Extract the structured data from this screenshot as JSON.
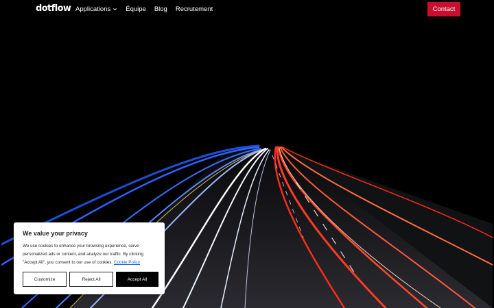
{
  "nav": {
    "logo": "dotflow",
    "items": [
      {
        "label": "Applications",
        "has_dropdown": true
      },
      {
        "label": "Équipe"
      },
      {
        "label": "Blog"
      },
      {
        "label": "Recrutement"
      }
    ],
    "contact_label": "Contact",
    "accent_color": "#c8102e"
  },
  "hero": {
    "image": "highway-light-trails-night"
  },
  "cookie": {
    "title": "We value your privacy",
    "text": "We use cookies to enhance your browsing experience, serve personalized ads or content, and analyze our traffic. By clicking \"Accept All\", you consent to our use of cookies.",
    "link_label": "Cookie Policy",
    "buttons": {
      "customize": "Customize",
      "reject": "Reject All",
      "accept": "Accept All"
    }
  }
}
